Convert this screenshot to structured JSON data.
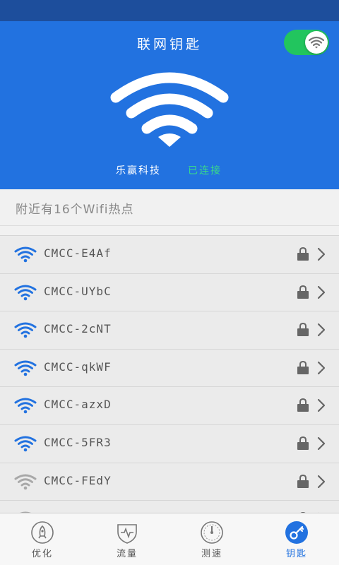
{
  "header": {
    "title": "联网钥匙",
    "toggle_on": true,
    "company": "乐赢科技",
    "status": "已连接"
  },
  "nearby": {
    "text": "附近有16个Wifi热点"
  },
  "networks": [
    {
      "ssid": "CMCC-E4Af",
      "signal": "strong",
      "locked": true
    },
    {
      "ssid": "CMCC-UYbC",
      "signal": "strong",
      "locked": true
    },
    {
      "ssid": "CMCC-2cNT",
      "signal": "strong",
      "locked": true
    },
    {
      "ssid": "CMCC-qkWF",
      "signal": "strong",
      "locked": true
    },
    {
      "ssid": "CMCC-azxD",
      "signal": "strong",
      "locked": true
    },
    {
      "ssid": "CMCC-5FR3",
      "signal": "strong",
      "locked": true
    },
    {
      "ssid": "CMCC-FEdY",
      "signal": "weak",
      "locked": true
    },
    {
      "ssid": "",
      "signal": "weak",
      "locked": true
    }
  ],
  "tabs": [
    {
      "label": "优化",
      "icon": "rocket-icon",
      "active": false
    },
    {
      "label": "流量",
      "icon": "pulse-shield-icon",
      "active": false
    },
    {
      "label": "测速",
      "icon": "speedometer-icon",
      "active": false
    },
    {
      "label": "钥匙",
      "icon": "key-icon",
      "active": true
    }
  ],
  "colors": {
    "status_bar": "#1d4e9c",
    "hero": "#2272e0",
    "toggle": "#22c55e",
    "connected": "#39d98a",
    "wifi_strong": "#2272e0",
    "wifi_weak": "#a8a8a8"
  }
}
